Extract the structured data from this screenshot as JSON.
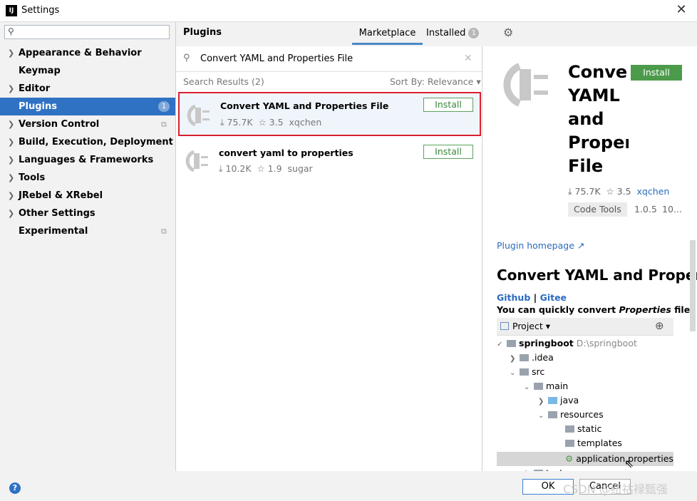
{
  "window": {
    "title": "Settings",
    "app_icon": "IJ"
  },
  "sidebar": {
    "search_placeholder": "",
    "items": [
      {
        "label": "Appearance & Behavior",
        "expandable": true
      },
      {
        "label": "Keymap",
        "expandable": false
      },
      {
        "label": "Editor",
        "expandable": true
      },
      {
        "label": "Plugins",
        "expandable": false,
        "selected": true,
        "badge": "1"
      },
      {
        "label": "Version Control",
        "expandable": true,
        "project_icon": true
      },
      {
        "label": "Build, Execution, Deployment",
        "expandable": true
      },
      {
        "label": "Languages & Frameworks",
        "expandable": true
      },
      {
        "label": "Tools",
        "expandable": true
      },
      {
        "label": "JRebel & XRebel",
        "expandable": true
      },
      {
        "label": "Other Settings",
        "expandable": true
      },
      {
        "label": "Experimental",
        "expandable": false,
        "project_icon": true
      }
    ]
  },
  "header": {
    "title": "Plugins",
    "tabs": [
      {
        "label": "Marketplace",
        "active": true
      },
      {
        "label": "Installed",
        "badge": "1"
      }
    ]
  },
  "search": {
    "value": "Convert YAML and Properties File"
  },
  "results": {
    "label": "Search Results (2)",
    "sort": "Sort By: Relevance",
    "items": [
      {
        "name": "Convert YAML and Properties File",
        "downloads": "75.7K",
        "rating": "3.5",
        "author": "xqchen",
        "action": "Install",
        "selected": true
      },
      {
        "name": "convert yaml to properties",
        "downloads": "10.2K",
        "rating": "1.9",
        "author": "sugar",
        "action": "Install"
      }
    ]
  },
  "detail": {
    "title": "Convert\nYAML\nand\nProperties\nFile",
    "install": "Install",
    "downloads": "75.7K",
    "rating": "3.5",
    "author": "xqchen",
    "tag": "Code Tools",
    "version": "1.0.5",
    "date": "10...",
    "homepage": "Plugin homepage ↗",
    "heading": "Convert YAML and Properties File",
    "link_github": "Github",
    "link_sep": "|",
    "link_gitee": "Gitee",
    "desc_prefix": "You can quickly convert ",
    "desc_em": "Properties",
    "desc_suffix": " files",
    "tree": {
      "header": "Project",
      "root": "springboot",
      "root_path": "D:\\springboot",
      "nodes": [
        ".idea",
        "src",
        "main",
        "java",
        "resources",
        "static",
        "templates",
        "application.properties",
        "test"
      ]
    }
  },
  "footer": {
    "ok": "OK",
    "cancel": "Cancel",
    "help": "?"
  },
  "watermark": "CSDN @纽祜禄甄强",
  "colors": {
    "accent": "#2f72c4",
    "install_green": "#4b9b4b",
    "selection_border": "#d8202e",
    "link": "#2a6bbf"
  }
}
